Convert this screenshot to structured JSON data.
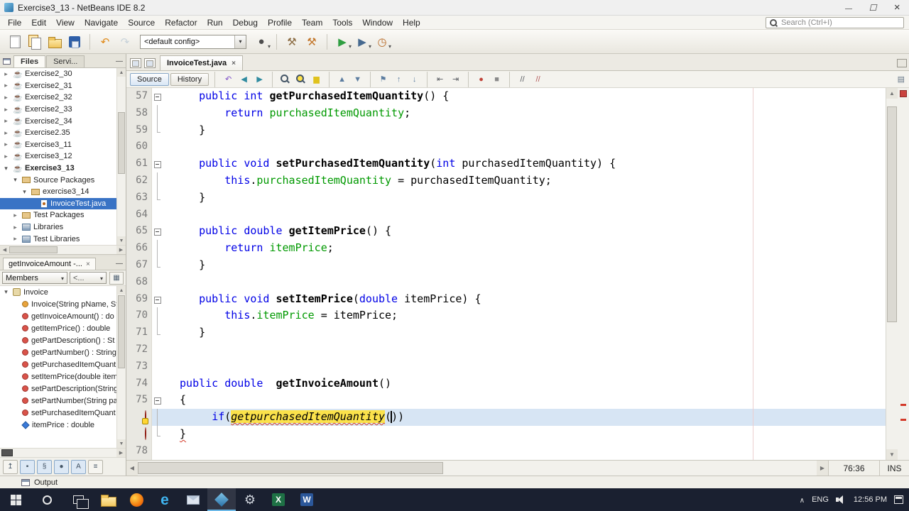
{
  "titlebar": {
    "title": "Exercise3_13 - NetBeans IDE 8.2"
  },
  "menubar": {
    "items": [
      "File",
      "Edit",
      "View",
      "Navigate",
      "Source",
      "Refactor",
      "Run",
      "Debug",
      "Profile",
      "Team",
      "Tools",
      "Window",
      "Help"
    ],
    "search_placeholder": "Search (Ctrl+I)"
  },
  "main_toolbar": {
    "config_value": "<default config>",
    "left_icons": [
      {
        "name": "new-file-button",
        "shape": "page"
      },
      {
        "name": "new-project-button",
        "shape": "pages"
      },
      {
        "name": "open-project-button",
        "shape": "folder"
      },
      {
        "name": "save-all-button",
        "shape": "disk"
      },
      {
        "name": "sep"
      },
      {
        "name": "undo-button",
        "glyph": "↶",
        "color": "#e08a1a"
      },
      {
        "name": "redo-button",
        "glyph": "↷",
        "color": "#8aa6c2",
        "disabled": true
      }
    ],
    "right_icons": [
      {
        "name": "project-configuration-button",
        "glyph": "●",
        "color": "#4d4d4d",
        "dd": true
      },
      {
        "name": "sep"
      },
      {
        "name": "build-project-button",
        "glyph": "⚒",
        "color": "#8a6b42"
      },
      {
        "name": "clean-build-project-button",
        "glyph": "⚒",
        "color": "#c2762a"
      },
      {
        "name": "sep"
      },
      {
        "name": "run-project-button",
        "glyph": "▶",
        "color": "#2f9e41",
        "dd": true
      },
      {
        "name": "debug-project-button",
        "glyph": "▶",
        "color": "#46698f",
        "dd": true
      },
      {
        "name": "profile-project-button",
        "glyph": "◷",
        "color": "#b86a26",
        "dd": true
      }
    ]
  },
  "files_panel": {
    "tabs": [
      {
        "label": "Files",
        "active": true
      },
      {
        "label": "Servi...",
        "active": false
      }
    ],
    "tree": [
      {
        "label": "Exercise2_30",
        "icon": "project",
        "arrow": "c",
        "indent": 0
      },
      {
        "label": "Exercise2_31",
        "icon": "project",
        "arrow": "c",
        "indent": 0
      },
      {
        "label": "Exercise2_32",
        "icon": "project",
        "arrow": "c",
        "indent": 0
      },
      {
        "label": "Exercise2_33",
        "icon": "project",
        "arrow": "c",
        "indent": 0
      },
      {
        "label": "Exercise2_34",
        "icon": "project",
        "arrow": "c",
        "indent": 0
      },
      {
        "label": "Exercise2.35",
        "icon": "project",
        "arrow": "c",
        "indent": 0
      },
      {
        "label": "Exercise3_11",
        "icon": "project",
        "arrow": "c",
        "indent": 0
      },
      {
        "label": "Exercise3_12",
        "icon": "project",
        "arrow": "c",
        "indent": 0
      },
      {
        "label": "Exercise3_13",
        "icon": "project",
        "arrow": "e",
        "indent": 0,
        "bold": true
      },
      {
        "label": "Source Packages",
        "icon": "pkgroot",
        "arrow": "e",
        "indent": 1
      },
      {
        "label": "exercise3_14",
        "icon": "package",
        "arrow": "e",
        "indent": 2
      },
      {
        "label": "InvoiceTest.java",
        "icon": "java",
        "arrow": "n",
        "indent": 3,
        "selected": true
      },
      {
        "label": "Test Packages",
        "icon": "pkgroot",
        "arrow": "c",
        "indent": 1
      },
      {
        "label": "Libraries",
        "icon": "lib",
        "arrow": "c",
        "indent": 1
      },
      {
        "label": "Test Libraries",
        "icon": "lib",
        "arrow": "c",
        "indent": 1
      }
    ]
  },
  "navigator": {
    "tab_label": "getInvoiceAmount -...",
    "filter_label": "Members",
    "filter2_label": "<...",
    "members": [
      {
        "label": "Invoice",
        "icon": "class",
        "arrow": "e",
        "indent": 0
      },
      {
        "label": "Invoice(String pName, St",
        "icon": "ctor",
        "arrow": "n",
        "indent": 1
      },
      {
        "label": "getInvoiceAmount() : do",
        "icon": "method",
        "arrow": "n",
        "indent": 1
      },
      {
        "label": "getItemPrice() : double",
        "icon": "method",
        "arrow": "n",
        "indent": 1
      },
      {
        "label": "getPartDescription() : St",
        "icon": "method",
        "arrow": "n",
        "indent": 1
      },
      {
        "label": "getPartNumber() : String",
        "icon": "method",
        "arrow": "n",
        "indent": 1
      },
      {
        "label": "getPurchasedItemQuant",
        "icon": "method",
        "arrow": "n",
        "indent": 1
      },
      {
        "label": "setItemPrice(double item",
        "icon": "method",
        "arrow": "n",
        "indent": 1
      },
      {
        "label": "setPartDescription(String",
        "icon": "method",
        "arrow": "n",
        "indent": 1
      },
      {
        "label": "setPartNumber(String pa",
        "icon": "method",
        "arrow": "n",
        "indent": 1
      },
      {
        "label": "setPurchasedItemQuant",
        "icon": "method",
        "arrow": "n",
        "indent": 1
      },
      {
        "label": "itemPrice : double",
        "icon": "field",
        "arrow": "n",
        "indent": 1
      }
    ],
    "filter_buttons": [
      {
        "name": "show-inherited-members-button",
        "glyph": "↥"
      },
      {
        "name": "show-fields-button",
        "glyph": "▪",
        "pressed": true
      },
      {
        "name": "show-static-members-button",
        "glyph": "§",
        "pressed": true
      },
      {
        "name": "show-non-public-members-button",
        "glyph": "●",
        "pressed": true
      },
      {
        "name": "sort-by-name-button",
        "glyph": "A",
        "pressed": true
      },
      {
        "name": "sort-by-source-button",
        "glyph": "≡"
      }
    ]
  },
  "editor": {
    "tab_label": "InvoiceTest.java",
    "source_label": "Source",
    "history_label": "History",
    "status_position": "76:36",
    "status_mode": "INS",
    "toolbar_icons": [
      {
        "name": "last-edit-position-button",
        "glyph": "↶",
        "color": "#7d4ec7"
      },
      {
        "name": "back-button",
        "glyph": "◀",
        "color": "#2f8ba0"
      },
      {
        "name": "forward-button",
        "glyph": "▶",
        "color": "#2f8ba0"
      },
      {
        "name": "sep"
      },
      {
        "name": "find-selection-button",
        "shape": "mag"
      },
      {
        "name": "find-occurrences-button",
        "shape": "mag2"
      },
      {
        "name": "toggle-highlight-search-button",
        "glyph": "▆",
        "color": "#e0c21c"
      },
      {
        "name": "sep"
      },
      {
        "name": "previous-occurrence-button",
        "glyph": "▲",
        "color": "#5c7da0"
      },
      {
        "name": "next-occurrence-button",
        "glyph": "▼",
        "color": "#5c7da0"
      },
      {
        "name": "sep"
      },
      {
        "name": "toggle-bookmark-button",
        "glyph": "⚑",
        "color": "#5c7da0"
      },
      {
        "name": "previous-bookmark-button",
        "glyph": "↑",
        "color": "#5c7da0"
      },
      {
        "name": "next-bookmark-button",
        "glyph": "↓",
        "color": "#5c7da0"
      },
      {
        "name": "sep"
      },
      {
        "name": "shift-left-button",
        "glyph": "⇤",
        "color": "#55585e"
      },
      {
        "name": "shift-right-button",
        "glyph": "⇥",
        "color": "#55585e"
      },
      {
        "name": "sep"
      },
      {
        "name": "start-macro-recording-button",
        "glyph": "●",
        "color": "#c04238"
      },
      {
        "name": "stop-macro-recording-button",
        "glyph": "■",
        "color": "#8a8a8a"
      },
      {
        "name": "sep"
      },
      {
        "name": "comment-button",
        "glyph": "//",
        "color": "#55585e"
      },
      {
        "name": "uncomment-button",
        "glyph": "//",
        "color": "#b05555"
      }
    ],
    "lines": [
      {
        "n": 57,
        "g": "n",
        "f": "box",
        "tk": [
          [
            "    ",
            "p"
          ],
          [
            "public",
            "k"
          ],
          [
            " ",
            "p"
          ],
          [
            "int",
            "k"
          ],
          [
            " ",
            "p"
          ],
          [
            "getPurchasedItemQuantity",
            "m"
          ],
          [
            "() {",
            "p"
          ]
        ]
      },
      {
        "n": 58,
        "g": "n",
        "f": "line",
        "tk": [
          [
            "        ",
            "p"
          ],
          [
            "return",
            "k"
          ],
          [
            " ",
            "p"
          ],
          [
            "purchasedItemQuantity",
            "f"
          ],
          [
            ";",
            "p"
          ]
        ]
      },
      {
        "n": 59,
        "g": "n",
        "f": "end",
        "tk": [
          [
            "    }",
            "p"
          ]
        ]
      },
      {
        "n": 60,
        "g": "n",
        "f": "",
        "tk": []
      },
      {
        "n": 61,
        "g": "n",
        "f": "box",
        "tk": [
          [
            "    ",
            "p"
          ],
          [
            "public",
            "k"
          ],
          [
            " ",
            "p"
          ],
          [
            "void",
            "k"
          ],
          [
            " ",
            "p"
          ],
          [
            "setPurchasedItemQuantity",
            "m"
          ],
          [
            "(",
            "p"
          ],
          [
            "int",
            "k"
          ],
          [
            " purchasedItemQuantity) {",
            "p"
          ]
        ]
      },
      {
        "n": 62,
        "g": "n",
        "f": "line",
        "tk": [
          [
            "        ",
            "p"
          ],
          [
            "this",
            "k"
          ],
          [
            ".",
            "p"
          ],
          [
            "purchasedItemQuantity",
            "f"
          ],
          [
            " = purchasedItemQuantity;",
            "p"
          ]
        ]
      },
      {
        "n": 63,
        "g": "n",
        "f": "end",
        "tk": [
          [
            "    }",
            "p"
          ]
        ]
      },
      {
        "n": 64,
        "g": "n",
        "f": "",
        "tk": []
      },
      {
        "n": 65,
        "g": "n",
        "f": "box",
        "tk": [
          [
            "    ",
            "p"
          ],
          [
            "public",
            "k"
          ],
          [
            " ",
            "p"
          ],
          [
            "double",
            "k"
          ],
          [
            " ",
            "p"
          ],
          [
            "getItemPrice",
            "m"
          ],
          [
            "() {",
            "p"
          ]
        ]
      },
      {
        "n": 66,
        "g": "n",
        "f": "line",
        "tk": [
          [
            "        ",
            "p"
          ],
          [
            "return",
            "k"
          ],
          [
            " ",
            "p"
          ],
          [
            "itemPrice",
            "f"
          ],
          [
            ";",
            "p"
          ]
        ]
      },
      {
        "n": 67,
        "g": "n",
        "f": "end",
        "tk": [
          [
            "    }",
            "p"
          ]
        ]
      },
      {
        "n": 68,
        "g": "n",
        "f": "",
        "tk": []
      },
      {
        "n": 69,
        "g": "n",
        "f": "box",
        "tk": [
          [
            "    ",
            "p"
          ],
          [
            "public",
            "k"
          ],
          [
            " ",
            "p"
          ],
          [
            "void",
            "k"
          ],
          [
            " ",
            "p"
          ],
          [
            "setItemPrice",
            "m"
          ],
          [
            "(",
            "p"
          ],
          [
            "double",
            "k"
          ],
          [
            " itemPrice) {",
            "p"
          ]
        ]
      },
      {
        "n": 70,
        "g": "n",
        "f": "line",
        "tk": [
          [
            "        ",
            "p"
          ],
          [
            "this",
            "k"
          ],
          [
            ".",
            "p"
          ],
          [
            "itemPrice",
            "f"
          ],
          [
            " = itemPrice;",
            "p"
          ]
        ]
      },
      {
        "n": 71,
        "g": "n",
        "f": "end",
        "tk": [
          [
            "    }",
            "p"
          ]
        ]
      },
      {
        "n": 72,
        "g": "n",
        "f": "",
        "tk": []
      },
      {
        "n": 73,
        "g": "n",
        "f": "",
        "tk": []
      },
      {
        "n": 74,
        "g": "n",
        "f": "",
        "tk": [
          [
            " ",
            "p"
          ],
          [
            "public",
            "k"
          ],
          [
            " ",
            "p"
          ],
          [
            "double",
            "k"
          ],
          [
            "  ",
            "p"
          ],
          [
            "getInvoiceAmount",
            "m"
          ],
          [
            "()",
            "p"
          ]
        ]
      },
      {
        "n": 75,
        "g": "n",
        "f": "box",
        "tk": [
          [
            " {",
            "p"
          ]
        ]
      },
      {
        "n": 76,
        "g": "eh",
        "f": "line",
        "cur": true,
        "tk": [
          [
            "      ",
            "p"
          ],
          [
            "if",
            "k"
          ],
          [
            "(",
            "p"
          ],
          [
            "getpurchasedItemQuantity",
            "occ"
          ],
          [
            "(",
            "p"
          ],
          [
            "",
            "caret"
          ],
          [
            ")",
            "p"
          ],
          [
            ")",
            "p"
          ]
        ]
      },
      {
        "n": 77,
        "g": "e",
        "f": "end",
        "tk": [
          [
            " ",
            "p"
          ],
          [
            "}",
            "errt"
          ]
        ]
      },
      {
        "n": 78,
        "g": "n",
        "f": "",
        "tk": []
      }
    ]
  },
  "output": {
    "label": "Output"
  },
  "taskbar": {
    "apps": [
      {
        "name": "file-explorer-icon",
        "kind": "folder"
      },
      {
        "name": "firefox-icon",
        "kind": "firefox"
      },
      {
        "name": "edge-icon",
        "kind": "edge"
      },
      {
        "name": "mail-icon",
        "kind": "mail"
      },
      {
        "name": "netbeans-icon",
        "kind": "netbeans",
        "active": true
      },
      {
        "name": "settings-icon",
        "kind": "gear"
      },
      {
        "name": "excel-icon",
        "kind": "excel"
      },
      {
        "name": "word-icon",
        "kind": "word"
      }
    ],
    "language": "ENG",
    "time": "12:56 PM"
  }
}
